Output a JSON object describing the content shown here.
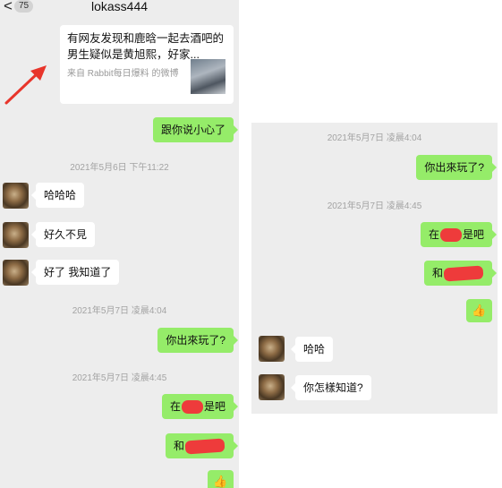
{
  "left": {
    "header": {
      "back_glyph": "<",
      "unread_count": "75",
      "contact_name": "lokass444"
    },
    "share_card": {
      "title": "有网友发现和鹿晗一起去酒吧的男生疑似是黄旭熙，好家...",
      "source": "来自 Rabbit每日爆料 的微博"
    },
    "messages": {
      "m1": "跟你说小心了",
      "ts1": "2021年5月6日 下午11:22",
      "m2": "哈哈哈",
      "m3": "好久不見",
      "m4": "好了 我知道了",
      "ts2": "2021年5月7日 凌晨4:04",
      "m5": "你出來玩了?",
      "ts3": "2021年5月7日 凌晨4:45",
      "m6_pre": "在",
      "m6_post": "是吧",
      "m7_pre": "和"
    }
  },
  "right": {
    "messages": {
      "ts1": "2021年5月7日 凌晨4:04",
      "m1": "你出來玩了?",
      "ts2": "2021年5月7日 凌晨4:45",
      "m2_pre": "在",
      "m2_post": "是吧",
      "m3_pre": "和",
      "m4": "哈哈",
      "m5": "你怎樣知道?"
    }
  },
  "icons": {
    "thumbs_up": "👍",
    "arrow": "red-arrow"
  },
  "colors": {
    "outgoing_bubble": "#95ec69",
    "incoming_bubble": "#ffffff",
    "background": "#ededed",
    "redaction": "#ee3b3b",
    "annotation_arrow": "#e8352b"
  }
}
